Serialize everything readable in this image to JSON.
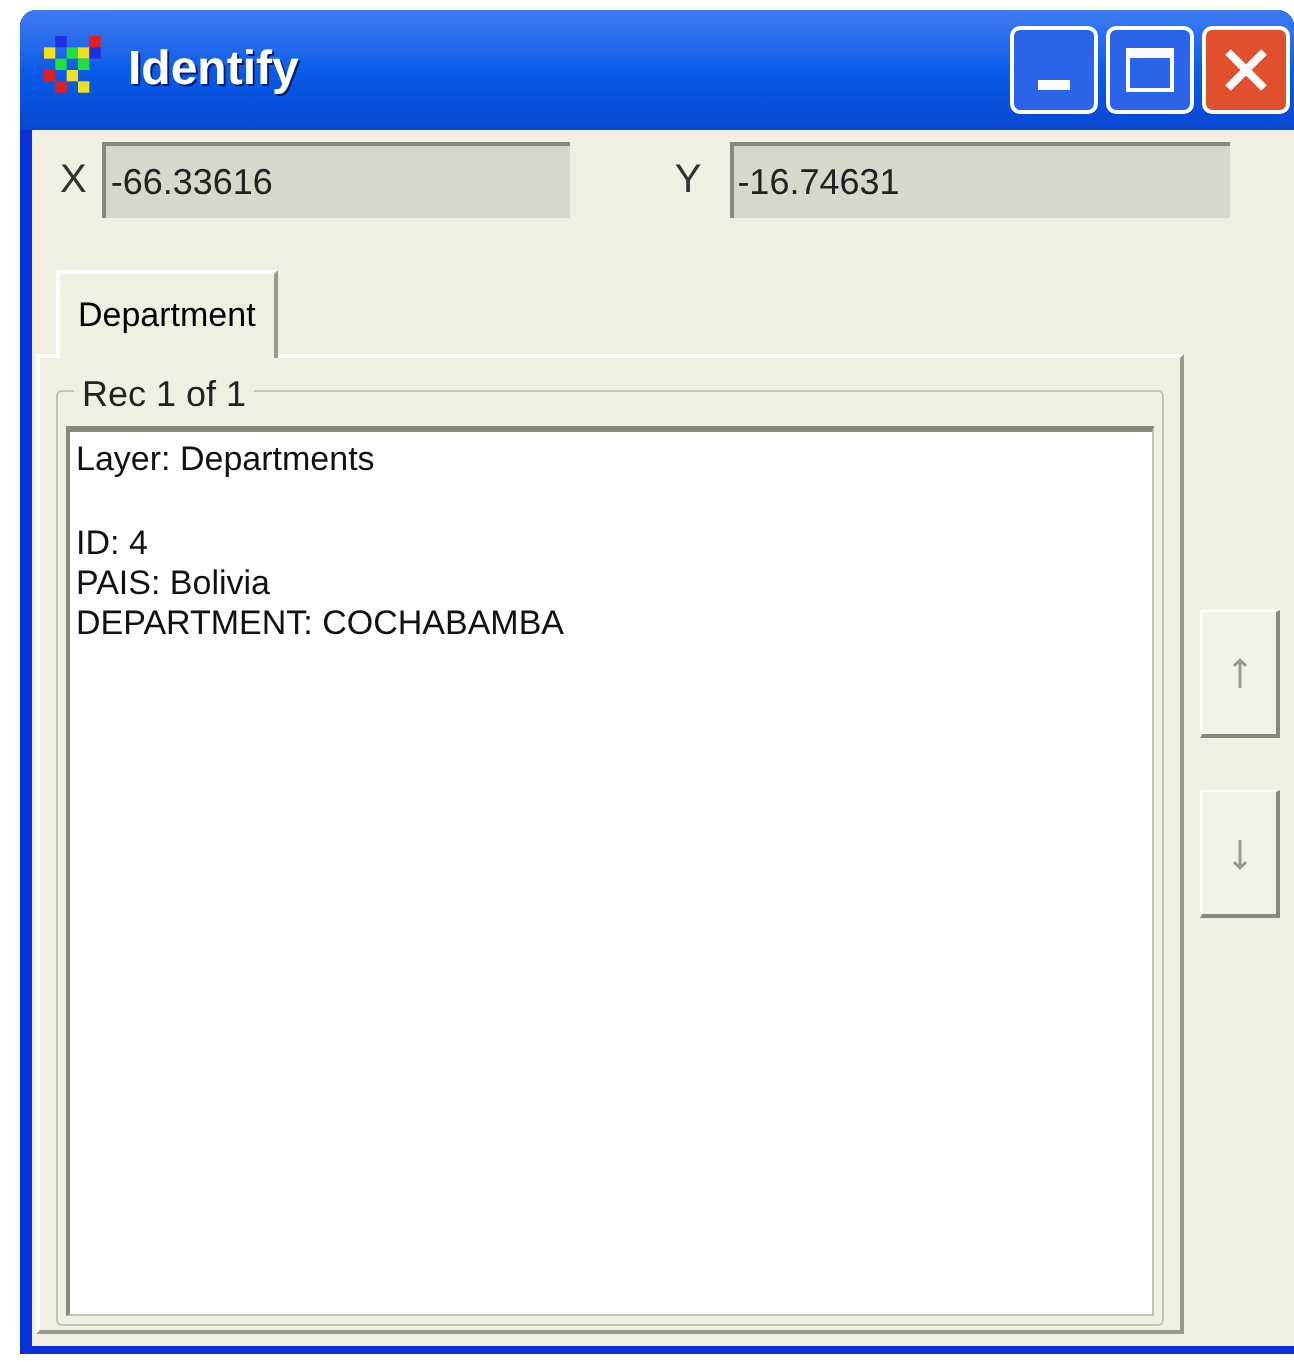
{
  "window": {
    "title": "Identify"
  },
  "coordinates": {
    "x_label": "X",
    "x_value": "-66.33616",
    "y_label": "Y",
    "y_value": "-16.74631"
  },
  "tabs": [
    {
      "label": "Department",
      "selected": true
    }
  ],
  "record_group": {
    "title": "Rec 1 of 1",
    "layer": "Layer: Departments",
    "fields": [
      "ID: 4",
      "PAIS: Bolivia",
      "DEPARTMENT: COCHABAMBA"
    ]
  }
}
